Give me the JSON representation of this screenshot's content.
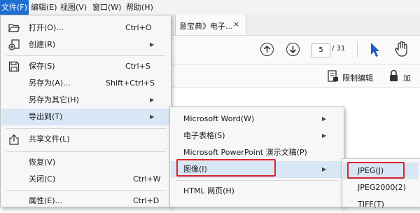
{
  "menubar": {
    "items": [
      "文件(F)",
      "编辑(E)",
      "视图(V)",
      "窗口(W)",
      "帮助(H)"
    ]
  },
  "tab": {
    "title": "意宝典》电子...",
    "close": "×"
  },
  "toolbar": {
    "page_current": "5",
    "page_total": "/ 31"
  },
  "subbar": {
    "restrict_edit": "限制编辑",
    "more": "加"
  },
  "file_menu": {
    "items": [
      {
        "label": "打开(O)...",
        "shortcut": "Ctrl+O",
        "icon": "folder-open-icon"
      },
      {
        "label": "创建(R)",
        "submenu": true,
        "icon": "create-pdf-icon"
      },
      {
        "label": "保存(S)",
        "shortcut": "Ctrl+S",
        "icon": "save-icon"
      },
      {
        "label": "另存为(A)...",
        "shortcut": "Shift+Ctrl+S"
      },
      {
        "label": "另存为其它(H)",
        "submenu": true
      },
      {
        "label": "导出到(T)",
        "submenu": true
      },
      {
        "label": "共享文件(L)",
        "icon": "share-icon"
      },
      {
        "label": "恢复(V)"
      },
      {
        "label": "关闭(C)",
        "shortcut": "Ctrl+W"
      },
      {
        "label": "属性(E)...",
        "shortcut": "Ctrl+D"
      }
    ]
  },
  "export_menu": {
    "items": [
      {
        "label": "Microsoft Word(W)",
        "submenu": true
      },
      {
        "label": "电子表格(S)",
        "submenu": true
      },
      {
        "label": "Microsoft PowerPoint 演示文稿(P)"
      },
      {
        "label": "图像(I)",
        "submenu": true
      },
      {
        "label": "HTML 网页(H)"
      }
    ]
  },
  "image_menu": {
    "items": [
      {
        "label": "JPEG(J)"
      },
      {
        "label": "JPEG2000(2)"
      },
      {
        "label": "TIFF(T)"
      }
    ]
  },
  "highlight_color": "#d9242a",
  "menubar_active_color": "#1f6fd1"
}
